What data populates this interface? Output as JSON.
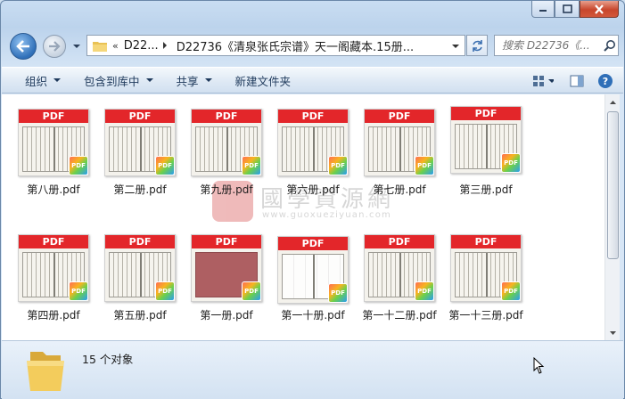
{
  "window": {
    "controls": [
      "minimize-icon",
      "maximize-icon",
      "close-icon"
    ]
  },
  "address": {
    "prefix": "«",
    "crumb1": "D22...",
    "crumb2": "D22736《清泉张氏宗谱》天一阁藏本.15册..."
  },
  "search": {
    "placeholder": "搜索 D22736《..."
  },
  "toolbar": {
    "organize": "组织",
    "include_in_library": "包含到库中",
    "share": "共享",
    "new_folder": "新建文件夹"
  },
  "files": [
    {
      "name": "第八册.pdf",
      "thumb_label": "PDF",
      "style": "book"
    },
    {
      "name": "第二册.pdf",
      "thumb_label": "PDF",
      "style": "book"
    },
    {
      "name": "第九册.pdf",
      "thumb_label": "PDF",
      "style": "book"
    },
    {
      "name": "第六册.pdf",
      "thumb_label": "PDF",
      "style": "book"
    },
    {
      "name": "第七册.pdf",
      "thumb_label": "PDF",
      "style": "book"
    },
    {
      "name": "第三册.pdf",
      "thumb_label": "PDF",
      "style": "book"
    },
    {
      "name": "第四册.pdf",
      "thumb_label": "PDF",
      "style": "book"
    },
    {
      "name": "第五册.pdf",
      "thumb_label": "PDF",
      "style": "book"
    },
    {
      "name": "第一册.pdf",
      "thumb_label": "PDF",
      "style": "red"
    },
    {
      "name": "第一十册.pdf",
      "thumb_label": "PDF",
      "style": "photo"
    },
    {
      "name": "第一十二册.pdf",
      "thumb_label": "PDF",
      "style": "book"
    },
    {
      "name": "第一十三册.pdf",
      "thumb_label": "PDF",
      "style": "book"
    }
  ],
  "badge_label": "PDF",
  "watermark": {
    "title": "國學資源網",
    "url": "www.guoxueziyuan.com"
  },
  "status": {
    "count": "15 个对象"
  },
  "colors": {
    "pdf_band": "#e3262a",
    "accent": "#2f6fb8"
  }
}
